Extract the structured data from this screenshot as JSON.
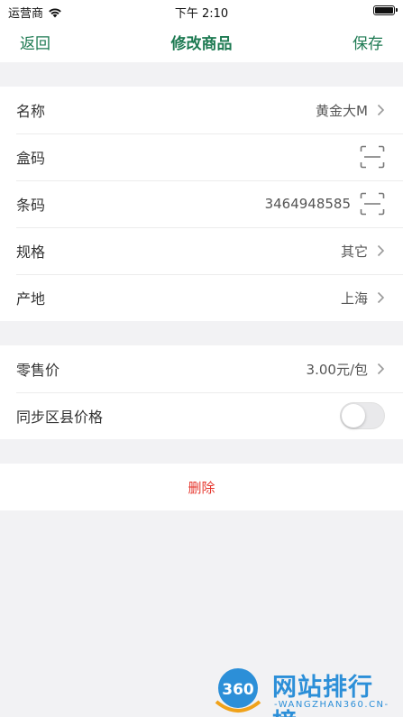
{
  "status_bar": {
    "carrier": "运营商",
    "time": "下午 2:10"
  },
  "nav": {
    "back_label": "返回",
    "title": "修改商品",
    "save_label": "保存"
  },
  "product_section": [
    {
      "label": "名称",
      "value": "黄金大M",
      "accessory": "chevron"
    },
    {
      "label": "盒码",
      "value": "",
      "accessory": "scan"
    },
    {
      "label": "条码",
      "value": "3464948585",
      "accessory": "scan"
    },
    {
      "label": "规格",
      "value": "其它",
      "accessory": "chevron"
    },
    {
      "label": "产地",
      "value": "上海",
      "accessory": "chevron"
    }
  ],
  "price_section": {
    "retail_price": {
      "label": "零售价",
      "value": "3.00元/包"
    },
    "sync_price": {
      "label": "同步区县价格",
      "enabled": false
    }
  },
  "delete_label": "删除",
  "watermark": {
    "logo_text": "360",
    "title": "网站排行榜",
    "subtitle": "-WANGZHAN360.CN-"
  },
  "colors": {
    "accent": "#1d7a52",
    "danger": "#e5352c",
    "background": "#f2f2f4"
  }
}
